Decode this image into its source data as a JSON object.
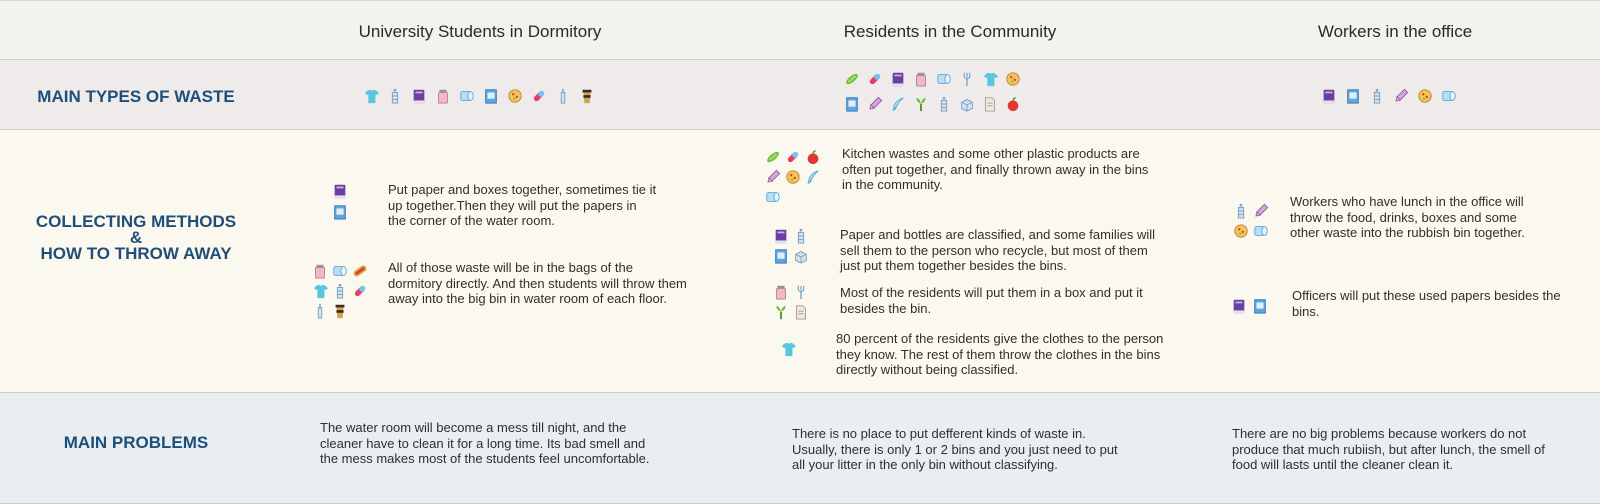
{
  "header": {
    "col1": "University Students in Dormitory",
    "col2": "Residents in the Community",
    "col3": "Workers in the office"
  },
  "rows": {
    "types": "MAIN TYPES OF WASTE",
    "collect_line1": "COLLECTING METHODS",
    "collect_amp": "&",
    "collect_line2": "HOW TO THROW AWAY",
    "problems": "MAIN PROBLEMS"
  },
  "types": {
    "col1_icons": [
      "shirt-icon",
      "bottle-icon",
      "book-icon",
      "jar-icon",
      "paper-roll-icon",
      "notebook-icon",
      "pizza-icon",
      "pill-icon",
      "small-bottle-icon",
      "coffee-cup-icon"
    ],
    "col2_icons_row1": [
      "pea-pod-icon",
      "pill-icon",
      "book-icon",
      "jar-icon",
      "paper-roll-icon",
      "fork-icon",
      "shirt-icon",
      "pizza-icon"
    ],
    "col2_icons_row2": [
      "notebook-icon",
      "pencil-icon",
      "feather-icon",
      "vegetable-icon",
      "bottle-icon",
      "box-icon",
      "document-icon",
      "apple-icon"
    ],
    "col3_icons": [
      "book-icon",
      "notebook-icon",
      "bottle-icon",
      "pencil-icon",
      "pizza-icon",
      "paper-roll-icon"
    ]
  },
  "collect": {
    "dorm_1": "Put paper and boxes together, sometimes tie it up together.Then they will put the papers in the corner of the water room.",
    "dorm_2": "All of those waste will be in the bags of the dormitory directly. And then students will throw them away into the big bin in water room of each floor.",
    "comm_1": "Kitchen wastes and some other plastic products are often put together, and finally thrown away in the bins in the community.",
    "comm_2": "Paper and bottles are classified, and some families will sell them to the person who recycle, but most of them just put them together besides the bins.",
    "comm_3": "Most of the residents will put them in a box and put it besides the bin.",
    "comm_4": "80 percent of the residents give the clothes to the person they know. The rest of them throw the clothes in the bins directly without being classified.",
    "office_1": "Workers who have lunch in the office will throw the food, drinks, boxes and some other waste into the rubbish bin together.",
    "office_2": "Officers will put these used papers besides the bins."
  },
  "problems": {
    "col1": "The water room will become a mess till night, and the cleaner have to clean it for a long time. Its bad smell and the mess makes most of the students feel uncomfortable.",
    "col2": "There is no place to put defferent kinds of waste in. Usually, there is only 1 or 2 bins and you just need to put all your litter in the only bin without classifying.",
    "col3": "There are no big problems because workers do not produce that much rubiish, but after lunch,  the smell of food will lasts until the cleaner clean it."
  },
  "colors": {
    "label": "#1f4f79",
    "header_bg": "#f1f3ec",
    "types_bg": "#efebea",
    "collect_bg": "#fbf8f0",
    "problems_bg": "#e8eef1"
  }
}
